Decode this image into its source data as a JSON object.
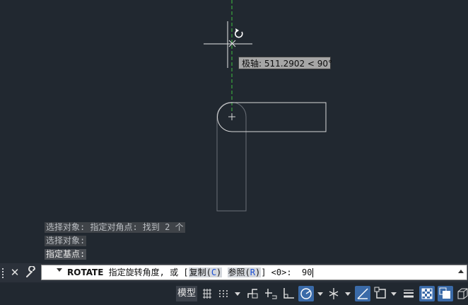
{
  "canvas": {
    "tooltip_text": "极轴: 511.2902 < 90°"
  },
  "history": [
    "选择对象: 指定对角点: 找到 2 个",
    "选择对象:",
    "指定基点:"
  ],
  "command": {
    "name": "ROTATE",
    "prompt": "指定旋转角度, 或 [",
    "option1_label": "复制(",
    "option1_key": "C",
    "option1_close": ")",
    "option2_label": "参照(",
    "option2_key": "R",
    "option2_close": ")",
    "suffix": "] <0>:  ",
    "input_value": "90"
  },
  "status": {
    "model_label": "模型",
    "icons": [
      "grid-icon",
      "snap-icon",
      "infer-constraints-icon",
      "dynamic-input-icon",
      "ortho-icon",
      "polar-tracking-icon",
      "isodraft-icon",
      "object-snap-tracking-icon",
      "object-snap-icon",
      "lineweight-icon",
      "transparency-icon",
      "selection-cycling-icon",
      "3d-osnap-icon"
    ]
  },
  "colors": {
    "canvas_bg": "#212830",
    "polar_line": "#3fbf3f",
    "geometry": "#d8d8d8",
    "active_toggle": "#3a6aa8"
  }
}
